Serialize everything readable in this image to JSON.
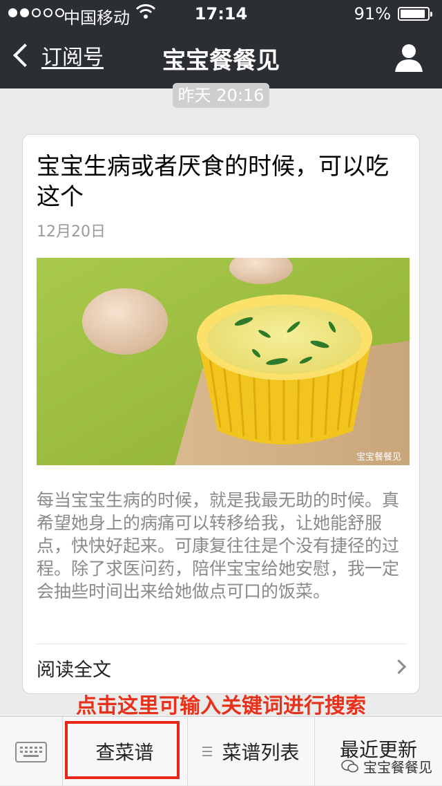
{
  "status_bar": {
    "carrier": "中国移动",
    "time": "17:14",
    "battery": "91%",
    "battery_level": 0.91
  },
  "nav": {
    "back_label": "订阅号",
    "title": "宝宝餐餐见"
  },
  "timestamp": "昨天 20:16",
  "article": {
    "title": "宝宝生病或者厌食的时候，可以吃这个",
    "date": "12月20日",
    "image_watermark": "宝宝餐餐见",
    "summary": "每当宝宝生病的时候，就是我最无助的时候。真希望她身上的病痛可以转移给我，让她能舒服点，快快好起来。可康复往往是个没有捷径的过程。除了求医问药，陪伴宝宝给她安慰，我一定会抽些时间出来给她做点可口的饭菜。",
    "read_more": "阅读全文"
  },
  "annotation": "点击这里可输入关键词进行搜索",
  "menu": {
    "items": [
      {
        "label": "查菜谱"
      },
      {
        "label": "菜谱列表"
      },
      {
        "label": "最近更新"
      }
    ]
  },
  "watermark": "宝宝餐餐见",
  "colors": {
    "topbar": "#2b2e33",
    "annotation_red": "#e8311a",
    "highlight_border": "#e8251a"
  }
}
